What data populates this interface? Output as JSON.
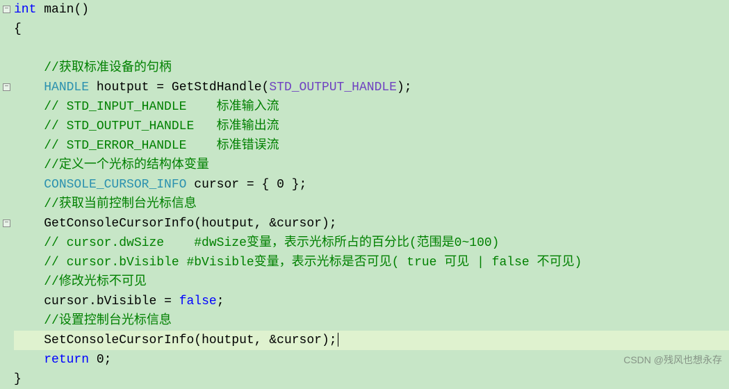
{
  "editor": {
    "fold_markers": [
      {
        "line": 0,
        "symbol": "−"
      },
      {
        "line": 4,
        "symbol": "−"
      },
      {
        "line": 11,
        "symbol": "−"
      }
    ],
    "indent_unit": "    ",
    "lines": [
      {
        "tokens": [
          {
            "t": "kw",
            "v": "int"
          },
          {
            "t": "sp",
            "v": " "
          },
          {
            "t": "func",
            "v": "main"
          },
          {
            "t": "paren",
            "v": "()"
          }
        ]
      },
      {
        "tokens": [
          {
            "t": "paren",
            "v": "{"
          }
        ]
      },
      {
        "tokens": []
      },
      {
        "indent": 1,
        "tokens": [
          {
            "t": "comment",
            "v": "//获取标准设备的句柄"
          }
        ]
      },
      {
        "indent": 1,
        "tokens": [
          {
            "t": "type",
            "v": "HANDLE"
          },
          {
            "t": "sp",
            "v": " "
          },
          {
            "t": "ident",
            "v": "houtput"
          },
          {
            "t": "sp",
            "v": " "
          },
          {
            "t": "op",
            "v": "="
          },
          {
            "t": "sp",
            "v": " "
          },
          {
            "t": "func",
            "v": "GetStdHandle"
          },
          {
            "t": "paren",
            "v": "("
          },
          {
            "t": "macro",
            "v": "STD_OUTPUT_HANDLE"
          },
          {
            "t": "paren",
            "v": ")"
          },
          {
            "t": "op",
            "v": ";"
          }
        ]
      },
      {
        "indent": 1,
        "tokens": [
          {
            "t": "comment",
            "v": "// STD_INPUT_HANDLE    标准输入流"
          }
        ]
      },
      {
        "indent": 1,
        "tokens": [
          {
            "t": "comment",
            "v": "// STD_OUTPUT_HANDLE   标准输出流"
          }
        ]
      },
      {
        "indent": 1,
        "tokens": [
          {
            "t": "comment",
            "v": "// STD_ERROR_HANDLE    标准错误流"
          }
        ]
      },
      {
        "indent": 1,
        "tokens": [
          {
            "t": "comment",
            "v": "//定义一个光标的结构体变量"
          }
        ]
      },
      {
        "indent": 1,
        "tokens": [
          {
            "t": "type",
            "v": "CONSOLE_CURSOR_INFO"
          },
          {
            "t": "sp",
            "v": " "
          },
          {
            "t": "ident",
            "v": "cursor"
          },
          {
            "t": "sp",
            "v": " "
          },
          {
            "t": "op",
            "v": "="
          },
          {
            "t": "sp",
            "v": " "
          },
          {
            "t": "paren",
            "v": "{ "
          },
          {
            "t": "num",
            "v": "0"
          },
          {
            "t": "paren",
            "v": " }"
          },
          {
            "t": "op",
            "v": ";"
          }
        ]
      },
      {
        "indent": 1,
        "tokens": [
          {
            "t": "comment",
            "v": "//获取当前控制台光标信息"
          }
        ]
      },
      {
        "indent": 1,
        "tokens": [
          {
            "t": "func",
            "v": "GetConsoleCursorInfo"
          },
          {
            "t": "paren",
            "v": "("
          },
          {
            "t": "ident",
            "v": "houtput"
          },
          {
            "t": "op",
            "v": ","
          },
          {
            "t": "sp",
            "v": " "
          },
          {
            "t": "op",
            "v": "&"
          },
          {
            "t": "ident",
            "v": "cursor"
          },
          {
            "t": "paren",
            "v": ")"
          },
          {
            "t": "op",
            "v": ";"
          }
        ]
      },
      {
        "indent": 1,
        "tokens": [
          {
            "t": "comment",
            "v": "// cursor.dwSize    #dwSize变量，表示光标所占的百分比(范围是0~100)"
          }
        ]
      },
      {
        "indent": 1,
        "tokens": [
          {
            "t": "comment",
            "v": "// cursor.bVisible #bVisible变量，表示光标是否可见( true 可见 | false 不可见)"
          }
        ]
      },
      {
        "indent": 1,
        "tokens": [
          {
            "t": "comment",
            "v": "//修改光标不可见"
          }
        ]
      },
      {
        "indent": 1,
        "tokens": [
          {
            "t": "ident",
            "v": "cursor"
          },
          {
            "t": "op",
            "v": "."
          },
          {
            "t": "ident",
            "v": "bVisible"
          },
          {
            "t": "sp",
            "v": " "
          },
          {
            "t": "op",
            "v": "="
          },
          {
            "t": "sp",
            "v": " "
          },
          {
            "t": "kw",
            "v": "false"
          },
          {
            "t": "op",
            "v": ";"
          }
        ]
      },
      {
        "indent": 1,
        "tokens": [
          {
            "t": "comment",
            "v": "//设置控制台光标信息"
          }
        ]
      },
      {
        "indent": 1,
        "highlight": true,
        "caret": true,
        "tokens": [
          {
            "t": "func",
            "v": "SetConsoleCursorInfo"
          },
          {
            "t": "paren",
            "v": "("
          },
          {
            "t": "ident",
            "v": "houtput"
          },
          {
            "t": "op",
            "v": ","
          },
          {
            "t": "sp",
            "v": " "
          },
          {
            "t": "op",
            "v": "&"
          },
          {
            "t": "ident",
            "v": "cursor"
          },
          {
            "t": "paren",
            "v": ")"
          },
          {
            "t": "op",
            "v": ";"
          }
        ]
      },
      {
        "indent": 1,
        "tokens": [
          {
            "t": "kw",
            "v": "return"
          },
          {
            "t": "sp",
            "v": " "
          },
          {
            "t": "num",
            "v": "0"
          },
          {
            "t": "op",
            "v": ";"
          }
        ]
      },
      {
        "tokens": [
          {
            "t": "paren",
            "v": "}"
          }
        ]
      }
    ]
  },
  "watermark": "CSDN @残风也想永存"
}
